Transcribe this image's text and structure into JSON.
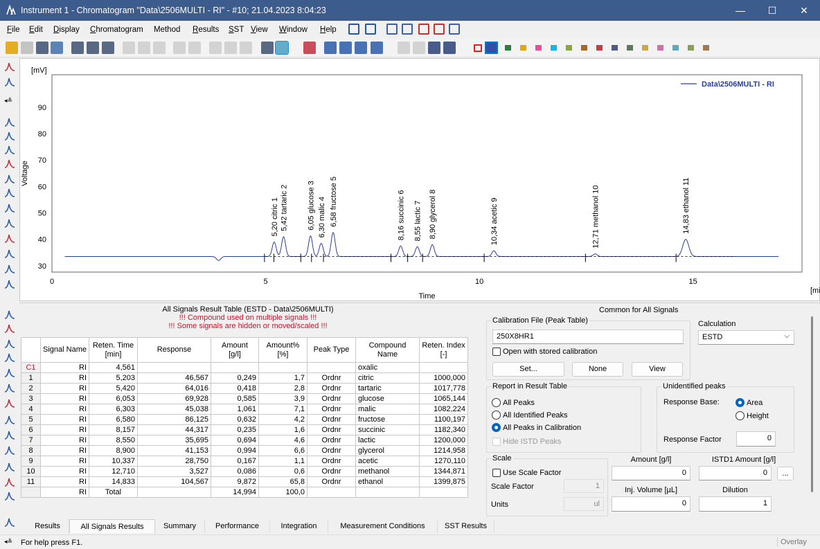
{
  "window": {
    "title": "Instrument 1 - Chromatogram \"Data\\2506MULTI - RI\" - #10;   21.04.2023    8:04:23",
    "minimize": "—",
    "maximize": "☐",
    "close": "✕"
  },
  "menu": [
    {
      "label": "File",
      "u": "F",
      "rest": "ile"
    },
    {
      "label": "Edit",
      "u": "E",
      "rest": "dit"
    },
    {
      "label": "Display",
      "u": "D",
      "rest": "isplay"
    },
    {
      "label": "Chromatogram",
      "u": "C",
      "rest": "hromatogram"
    },
    {
      "label": "Method",
      "u": "",
      "rest": "Method"
    },
    {
      "label": "Results",
      "u": "R",
      "rest": "esults"
    },
    {
      "label": "SST",
      "u": "S",
      "rest": "ST"
    },
    {
      "label": "View",
      "u": "V",
      "rest": "iew"
    },
    {
      "label": "Window",
      "u": "W",
      "rest": "indow"
    },
    {
      "label": "Help",
      "u": "H",
      "rest": "elp"
    }
  ],
  "colors": {
    "accent": "#0067c0",
    "signal": "#2a3f9a",
    "swatches": [
      "#3150a8",
      "#2a7f3a",
      "#e0a800",
      "#e84ea0",
      "#10b8e8",
      "#8aa83a",
      "#a86820",
      "#c04048",
      "#505a8a",
      "#5a7a58",
      "#c8a848",
      "#d070a8",
      "#60a8c0",
      "#8aa058",
      "#a07850"
    ]
  },
  "chart_data": {
    "type": "line",
    "ylabel": "Voltage",
    "yunit": "[mV]",
    "xlabel": "Time",
    "xunit": "[min]",
    "xlim": [
      0,
      17.55
    ],
    "ylim": [
      27.6,
      102.3
    ],
    "xticks": [
      0,
      5,
      10,
      15
    ],
    "yticks": [
      30,
      40,
      50,
      60,
      70,
      80,
      90
    ],
    "legend": "Data\\2506MULTI - RI",
    "legend_position": "top-right",
    "baseline_mV": 33.5,
    "peaks": [
      {
        "rt": 5.2,
        "height": 39,
        "label": "5,20 citric  1"
      },
      {
        "rt": 5.42,
        "height": 41,
        "label": "5,42 tartaric  2"
      },
      {
        "rt": 6.05,
        "height": 41.3,
        "label": "6,05 glucose  3"
      },
      {
        "rt": 6.3,
        "height": 38.5,
        "label": "6,30 malic  4"
      },
      {
        "rt": 6.58,
        "height": 42.6,
        "label": "6,58 fructose  5"
      },
      {
        "rt": 8.16,
        "height": 37.5,
        "label": "8,16 succinic  6"
      },
      {
        "rt": 8.55,
        "height": 37.2,
        "label": "8,55 lactic  7"
      },
      {
        "rt": 8.9,
        "height": 38,
        "label": "8,90 glycerol  8"
      },
      {
        "rt": 10.34,
        "height": 35.7,
        "label": "10,34 acetic  9"
      },
      {
        "rt": 12.71,
        "height": 34.5,
        "label": "12,71 methanol  10"
      },
      {
        "rt": 14.83,
        "height": 40,
        "label": "14,83 ethanol  11"
      }
    ]
  },
  "table": {
    "title": "All Signals Result Table (ESTD - Data\\2506MULTI)",
    "warn1": "!!! Compound used on multiple signals !!!",
    "warn2": "!!! Some signals are hidden or moved/scaled !!!",
    "headers": [
      "",
      "Signal Name",
      "Reten. Time\n[min]",
      "Response",
      "Amount\n[g/l]",
      "Amount%\n[%]",
      "Peak Type",
      "Compound Name",
      "Reten. Index\n[-]"
    ],
    "rows": [
      [
        "C1",
        "RI",
        "4,561",
        "",
        "",
        "",
        "",
        "oxalic",
        ""
      ],
      [
        "1",
        "RI",
        "5,203",
        "46,567",
        "0,249",
        "1,7",
        "Ordnr",
        "citric",
        "1000,000"
      ],
      [
        "2",
        "RI",
        "5,420",
        "64,016",
        "0,418",
        "2,8",
        "Ordnr",
        "tartaric",
        "1017,778"
      ],
      [
        "3",
        "RI",
        "6,053",
        "69,928",
        "0,585",
        "3,9",
        "Ordnr",
        "glucose",
        "1065,144"
      ],
      [
        "4",
        "RI",
        "6,303",
        "45,038",
        "1,061",
        "7,1",
        "Ordnr",
        "malic",
        "1082,224"
      ],
      [
        "5",
        "RI",
        "6,580",
        "86,125",
        "0,632",
        "4,2",
        "Ordnr",
        "fructose",
        "1100,197"
      ],
      [
        "6",
        "RI",
        "8,157",
        "44,317",
        "0,235",
        "1,6",
        "Ordnr",
        "succinic",
        "1182,340"
      ],
      [
        "7",
        "RI",
        "8,550",
        "35,695",
        "0,694",
        "4,6",
        "Ordnr",
        "lactic",
        "1200,000"
      ],
      [
        "8",
        "RI",
        "8,900",
        "41,153",
        "0,994",
        "6,6",
        "Ordnr",
        "glycerol",
        "1214,958"
      ],
      [
        "9",
        "RI",
        "10,337",
        "28,750",
        "0,167",
        "1,1",
        "Ordnr",
        "acetic",
        "1270,110"
      ],
      [
        "10",
        "RI",
        "12,710",
        "3,527",
        "0,086",
        "0,6",
        "Ordnr",
        "methanol",
        "1344,871"
      ],
      [
        "11",
        "RI",
        "14,833",
        "104,567",
        "9,872",
        "65,8",
        "Ordnr",
        "ethanol",
        "1399,875"
      ],
      [
        "",
        "RI",
        "Total",
        "",
        "14,994",
        "100,0",
        "",
        "",
        ""
      ]
    ]
  },
  "panel": {
    "heading": "Common for All Signals",
    "calib_legend": "Calibration File (Peak Table)",
    "calib_file": "250X8HR1",
    "open_stored": "Open with stored calibration",
    "set": "Set...",
    "none": "None",
    "view": "View",
    "calc_label": "Calculation",
    "calc_value": "ESTD",
    "report_legend": "Report in Result Table",
    "all_peaks": "All Peaks",
    "all_identified": "All Identified Peaks",
    "all_in_calib": "All Peaks in Calibration",
    "hide_istd": "Hide ISTD Peaks",
    "unid_legend": "Unidentified peaks",
    "response_base": "Response Base:",
    "area": "Area",
    "height": "Height",
    "response_factor_label": "Response Factor",
    "response_factor": "0",
    "scale_legend": "Scale",
    "use_scale": "Use Scale Factor",
    "scale_factor_label": "Scale Factor",
    "scale_factor": "1",
    "units_label": "Units",
    "units": "ul",
    "amount_label": "Amount [g/l]",
    "amount": "0",
    "istd_label": "ISTD1 Amount [g/l]",
    "istd": "0",
    "more": "...",
    "inj_label": "Inj. Volume [µL]",
    "inj": "0",
    "dilution_label": "Dilution",
    "dilution": "1"
  },
  "tabs": [
    "Results",
    "All Signals Results",
    "Summary",
    "Performance",
    "Integration",
    "Measurement Conditions",
    "SST Results"
  ],
  "active_tab": "All Signals Results",
  "status": {
    "help": "For help press F1.",
    "mode": "Overlay"
  }
}
